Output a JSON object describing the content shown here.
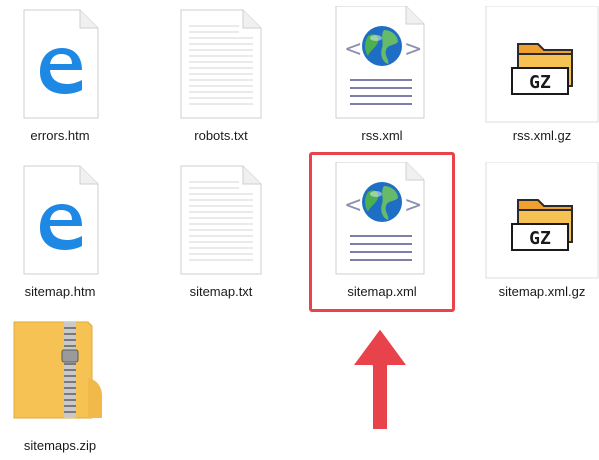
{
  "files": [
    {
      "name": "errors.htm",
      "type": "edge-htm"
    },
    {
      "name": "robots.txt",
      "type": "text"
    },
    {
      "name": "rss.xml",
      "type": "xml"
    },
    {
      "name": "rss.xml.gz",
      "type": "gz"
    },
    {
      "name": "sitemap.htm",
      "type": "edge-htm"
    },
    {
      "name": "sitemap.txt",
      "type": "text"
    },
    {
      "name": "sitemap.xml",
      "type": "xml"
    },
    {
      "name": "sitemap.xml.gz",
      "type": "gz"
    },
    {
      "name": "sitemaps.zip",
      "type": "zip"
    }
  ],
  "gz_badge": "GZ",
  "colors": {
    "highlight": "#e8424b",
    "arrow": "#e8424b",
    "edge_blue": "#1e88e5",
    "folder_yellow": "#f5c253"
  }
}
